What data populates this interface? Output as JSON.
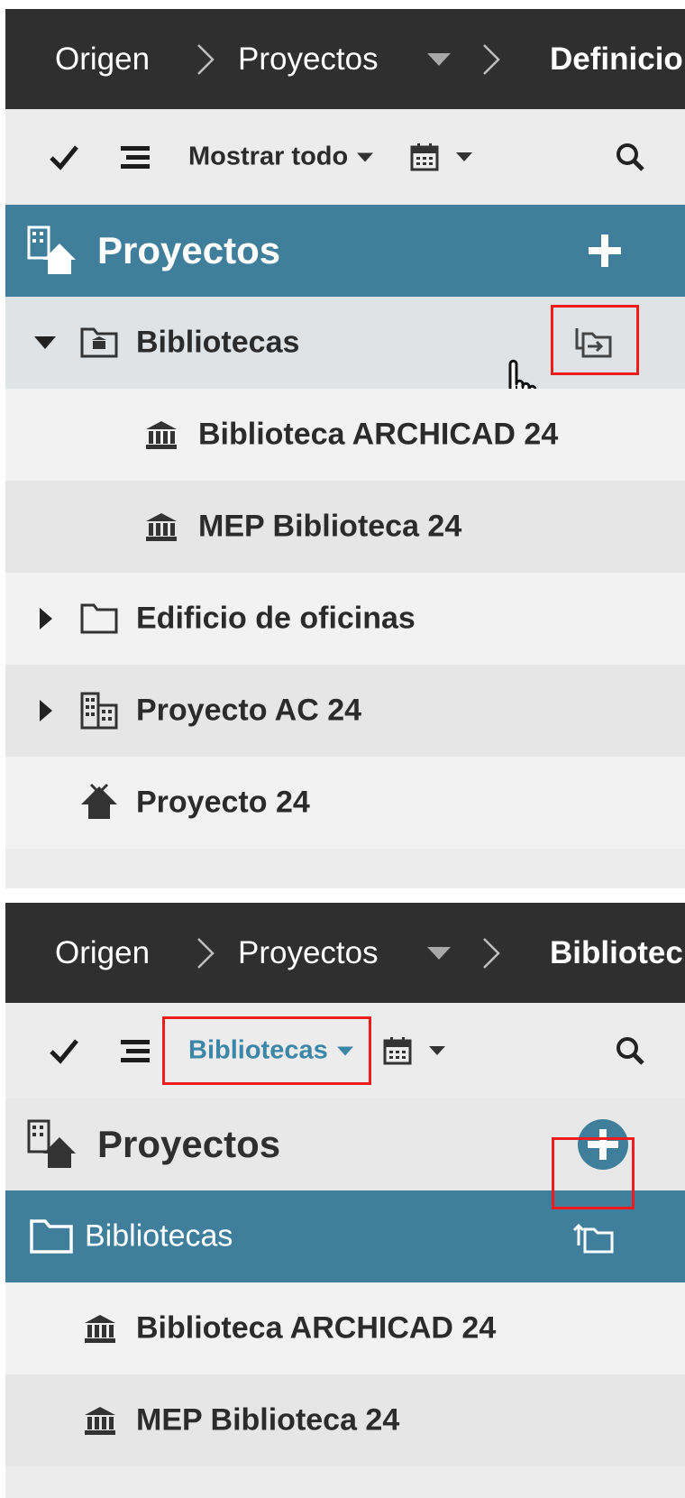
{
  "panel_top": {
    "breadcrumb": [
      {
        "label": "Origen"
      },
      {
        "label": "Proyectos"
      },
      {
        "label": "Definicio"
      }
    ],
    "toolbar": {
      "filter_label": "Mostrar todo",
      "icons": [
        "check-icon",
        "list-icon",
        "calendar-icon",
        "search-icon"
      ]
    },
    "header": {
      "title": "Proyectos",
      "add_icon": "plus-icon"
    },
    "rows": [
      {
        "label": "Bibliotecas",
        "icon": "library-folder-icon",
        "state": "expanded",
        "action_icon": "enter-folder-icon"
      },
      {
        "label": "Biblioteca ARCHICAD 24",
        "icon": "library-icon"
      },
      {
        "label": "MEP Biblioteca 24",
        "icon": "library-icon"
      },
      {
        "label": "Edificio de oficinas",
        "icon": "folder-icon",
        "state": "collapsed"
      },
      {
        "label": "Proyecto AC 24",
        "icon": "building-icon",
        "state": "collapsed"
      },
      {
        "label": "Proyecto 24",
        "icon": "house-icon"
      }
    ]
  },
  "panel_bottom": {
    "breadcrumb": [
      {
        "label": "Origen"
      },
      {
        "label": "Proyectos"
      },
      {
        "label": "Bibliotec"
      }
    ],
    "toolbar": {
      "filter_label": "Bibliotecas",
      "icons": [
        "check-icon",
        "list-icon",
        "calendar-icon",
        "search-icon"
      ]
    },
    "header": {
      "title": "Proyectos",
      "add_icon": "plus-circle-icon"
    },
    "current_folder": {
      "label": "Bibliotecas",
      "icon": "folder-icon",
      "action_icon": "exit-folder-icon"
    },
    "rows": [
      {
        "label": "Biblioteca ARCHICAD 24",
        "icon": "library-icon"
      },
      {
        "label": "MEP Biblioteca 24",
        "icon": "library-icon"
      }
    ]
  },
  "colors": {
    "breadcrumb_bg": "#2f2f2f",
    "accent": "#3f7f9b",
    "link_blue": "#3c86a8",
    "highlight_red": "#ee1c1c"
  }
}
